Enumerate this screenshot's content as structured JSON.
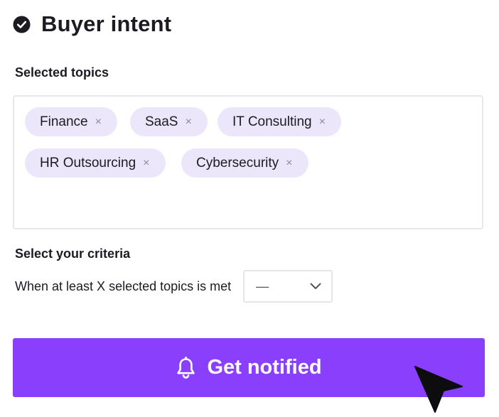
{
  "header": {
    "title": "Buyer intent",
    "icon": "check-circle-icon"
  },
  "topics": {
    "label": "Selected topics",
    "chips": [
      {
        "label": "Finance",
        "remove_icon": "×"
      },
      {
        "label": "SaaS",
        "remove_icon": "×"
      },
      {
        "label": "IT Consulting",
        "remove_icon": "×"
      },
      {
        "label": "HR Outsourcing",
        "remove_icon": "×"
      },
      {
        "label": "Cybersecurity",
        "remove_icon": "×"
      }
    ]
  },
  "criteria": {
    "label": "Select your criteria",
    "condition_text": "When at least X selected topics is met",
    "select_value": "—",
    "select_icon": "chevron-down-icon"
  },
  "action": {
    "button_label": "Get notified",
    "icon": "bell-icon",
    "background": "#8a3ffc"
  },
  "colors": {
    "chip_background": "#ece6fb",
    "text": "#1c1b22"
  }
}
